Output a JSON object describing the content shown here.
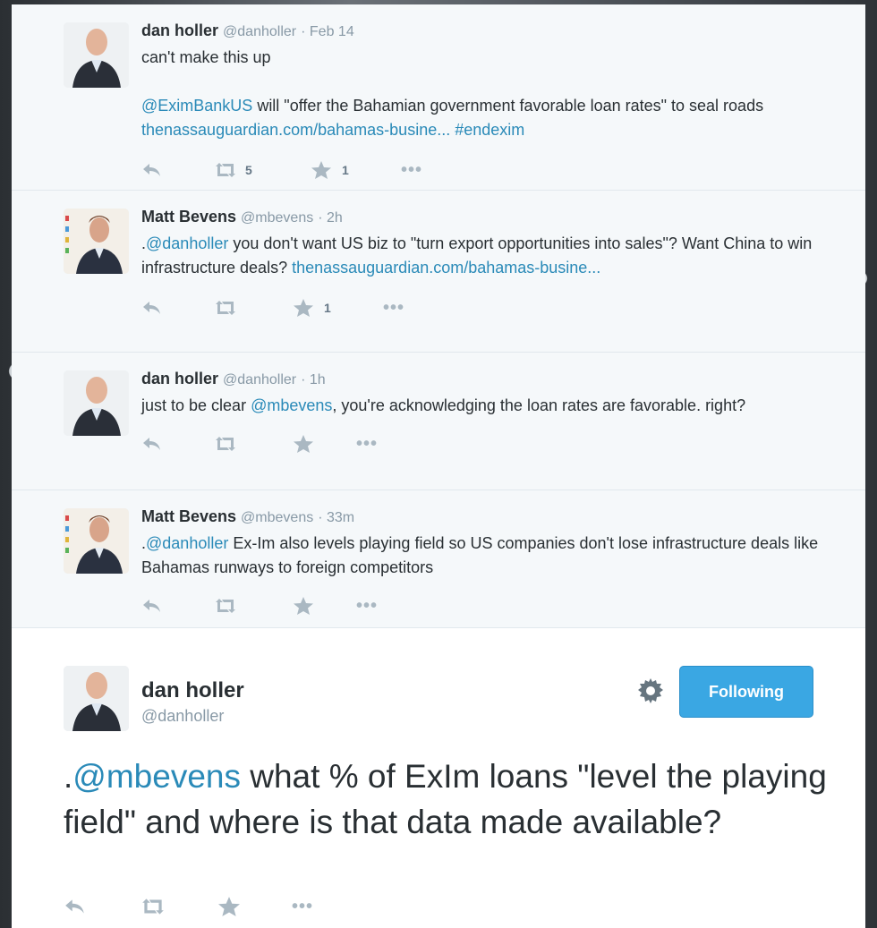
{
  "tweets": [
    {
      "name": "dan holler",
      "handle": "@danholler",
      "time": "· Feb 14",
      "line1": "can't make this up",
      "mention": "@EximBankUS",
      "text_a": " will \"offer the Bahamian government favorable loan rates\" to seal roads ",
      "link": "thenassauguardian.com/bahamas-busine...",
      "hashtag": "#endexim",
      "retweets": "5",
      "favorites": "1"
    },
    {
      "name": "Matt Bevens",
      "handle": "@mbevens",
      "time": "· 2h",
      "prefix": ".",
      "mention": "@danholler",
      "text_a": " you don't want US biz to \"turn export opportunities into sales\"? Want China to win infrastructure deals? ",
      "link": "thenassauguardian.com/bahamas-busine...",
      "favorites": "1"
    },
    {
      "name": "dan holler",
      "handle": "@danholler",
      "time": "· 1h",
      "text_a": "just to be clear ",
      "mention": "@mbevens",
      "text_b": ", you're acknowledging the loan rates are favorable. right?"
    },
    {
      "name": "Matt Bevens",
      "handle": "@mbevens",
      "time": "· 33m",
      "prefix": ".",
      "mention": "@danholler",
      "text_a": " Ex-Im also levels playing field so US companies don't lose infrastructure deals like Bahamas runways to foreign competitors"
    }
  ],
  "permalink": {
    "name": "dan holler",
    "handle": "@danholler",
    "follow_label": "Following",
    "prefix": ".",
    "mention": "@mbevens",
    "text": " what % of ExIm loans \"level the playing field\" and where is that data made available?"
  },
  "icons": {
    "reply": "reply-icon",
    "retweet": "retweet-icon",
    "favorite": "star-icon",
    "more": "more-dots-icon",
    "gear": "gear-icon"
  },
  "colors": {
    "link": "#2a8ab8",
    "follow_button": "#3aa7e3",
    "meta": "#8899a6"
  }
}
